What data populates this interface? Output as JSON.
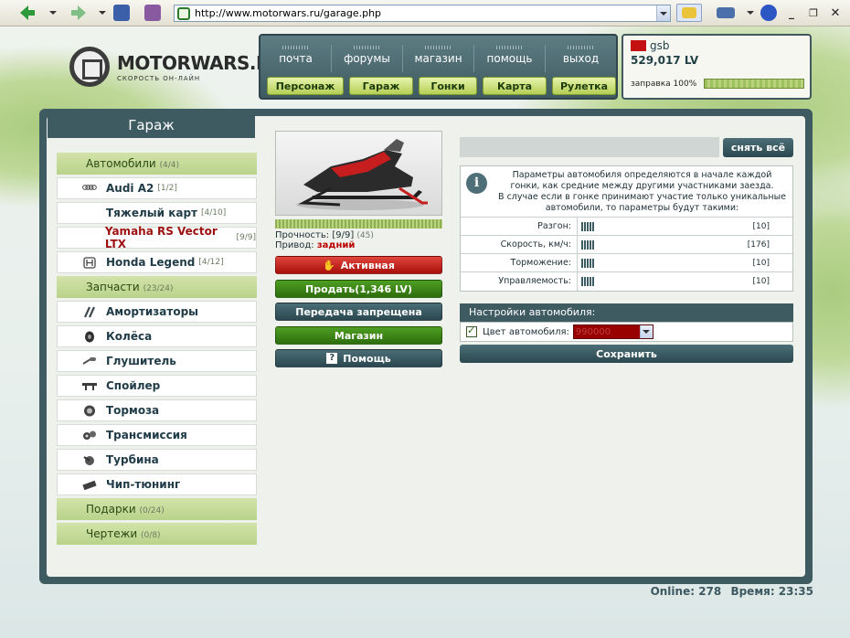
{
  "browser": {
    "url": "http://www.motorwars.ru/garage.php"
  },
  "logo": {
    "title": "MOTORWARS.RU",
    "subtitle": "СКОРОСТЬ ОН-ЛАЙН"
  },
  "nav": {
    "top": [
      "почта",
      "форумы",
      "магазин",
      "помощь",
      "выход"
    ],
    "bottom": [
      "Персонаж",
      "Гараж",
      "Гонки",
      "Карта",
      "Рулетка"
    ]
  },
  "user": {
    "name": "gsb",
    "money": "529,017 LV",
    "fuel_label": "заправка 100%",
    "fuel_percent": 100
  },
  "panel": {
    "title": "Гараж"
  },
  "sidebar": {
    "cars_group": {
      "label": "Автомобили",
      "count": "(4/4)"
    },
    "cars": [
      {
        "label": "Audi A2",
        "count": "[1/2]",
        "icon": "audi-logo-icon"
      },
      {
        "label": "Тяжелый карт",
        "count": "[4/10]",
        "icon": ""
      },
      {
        "label": "Yamaha RS Vector LTX",
        "count": "[9/9]",
        "icon": ""
      },
      {
        "label": "Honda Legend",
        "count": "[4/12]",
        "icon": "honda-logo-icon"
      }
    ],
    "parts_group": {
      "label": "Запчасти",
      "count": "(23/24)"
    },
    "parts": [
      {
        "label": "Амортизаторы",
        "icon": "shock-absorber-icon"
      },
      {
        "label": "Колёса",
        "icon": "wheel-icon"
      },
      {
        "label": "Глушитель",
        "icon": "muffler-icon"
      },
      {
        "label": "Спойлер",
        "icon": "spoiler-icon"
      },
      {
        "label": "Тормоза",
        "icon": "brake-disc-icon"
      },
      {
        "label": "Трансмиссия",
        "icon": "gears-icon"
      },
      {
        "label": "Турбина",
        "icon": "turbine-icon"
      },
      {
        "label": "Чип-тюнинг",
        "icon": "chip-icon"
      }
    ],
    "gifts_group": {
      "label": "Подарки",
      "count": "(0/24)"
    },
    "drawings_group": {
      "label": "Чертежи",
      "count": "(0/8)"
    }
  },
  "vehicle": {
    "durability_label": "Прочность:",
    "durability_value": "[9/9]",
    "durability_extra": "(45)",
    "durability_fraction": 1.0,
    "drive_label": "Привод:",
    "drive_value": "задний",
    "buttons": {
      "active": "Активная",
      "sell": "Продать(1,346 LV)",
      "transfer": "Передача запрещена",
      "shop": "Магазин",
      "help": "Помощь"
    }
  },
  "params": {
    "remove_all": "снять всё",
    "note": "Параметры автомобиля определяются в начале каждой гонки, как средние между другими участниками заезда.\nВ случае если в гонке принимают участие только уникальные автомобили, то параметры будут такими:",
    "rows": [
      {
        "label": "Разгон:",
        "value": "[10]"
      },
      {
        "label": "Скорость, км/ч:",
        "value": "[176]"
      },
      {
        "label": "Торможение:",
        "value": "[10]"
      },
      {
        "label": "Управляемость:",
        "value": "[10]"
      }
    ]
  },
  "settings": {
    "title": "Настройки автомобиля:",
    "color_label": "Цвет автомобиля:",
    "color_value": "990000",
    "color_hex": "#990000",
    "save": "Сохранить"
  },
  "footer": {
    "online": "Online: 278",
    "time": "Время: 23:35"
  }
}
